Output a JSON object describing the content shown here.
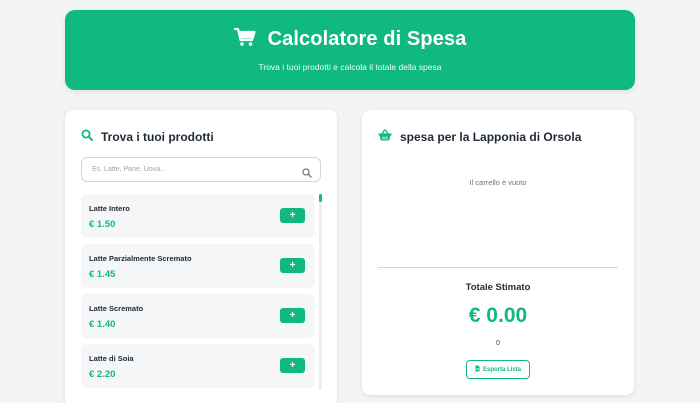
{
  "header": {
    "title": "Calcolatore di Spesa",
    "subtitle": "Trova i tuoi prodotti e calcola il totale della spesa",
    "icon": "cart-icon"
  },
  "search_panel": {
    "title": "Trova i tuoi prodotti",
    "icon": "search-icon",
    "search": {
      "placeholder": "Es. Latte, Pane, Uova...",
      "value": ""
    },
    "products": [
      {
        "name": "Latte Intero",
        "price": "€ 1.50",
        "add_label": "+"
      },
      {
        "name": "Latte Parzialmente Scremato",
        "price": "€ 1.45",
        "add_label": "+"
      },
      {
        "name": "Latte Scremato",
        "price": "€ 1.40",
        "add_label": "+"
      },
      {
        "name": "Latte di Soia",
        "price": "€ 2.20",
        "add_label": "+"
      }
    ]
  },
  "cart_panel": {
    "title": "spesa per la Lapponia di Orsola",
    "icon": "basket-icon",
    "empty_message": "Il carrello è vuoto",
    "total_label": "Totale Stimato",
    "total_value": "€ 0.00",
    "item_count": "0",
    "export_label": "Esporta Lista",
    "export_icon": "file-icon"
  },
  "colors": {
    "accent": "#10b981",
    "background": "#f3f4f6",
    "card": "#ffffff",
    "text": "#1f2937"
  }
}
